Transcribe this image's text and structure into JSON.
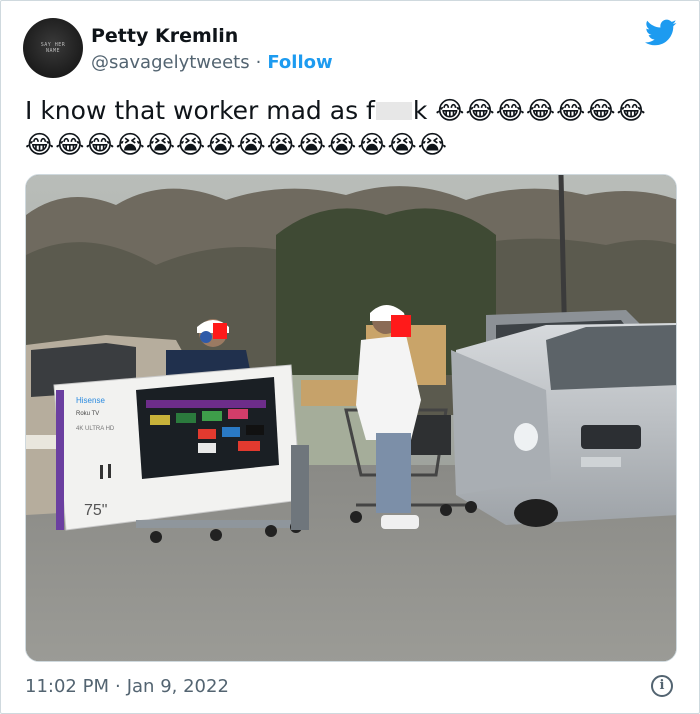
{
  "author": {
    "display_name": "Petty Kremlin",
    "handle": "@savagelytweets",
    "separator": "·",
    "follow_label": "Follow",
    "avatar_text": "SAY HER NAME"
  },
  "tweet": {
    "text_before": "I know that worker mad as f",
    "text_after": "k",
    "emoji_line1": "😂😂😂😂😂😂😂",
    "emoji_line2": "😂😂😂😭😭😭😭😭😭😭😭😭😭😭"
  },
  "photo": {
    "tv_brand": "Hisense",
    "tv_subtitle": "Roku TV",
    "tv_size": "75\"",
    "tv_model": "4K ULTRA HD"
  },
  "footer": {
    "time": "11:02 PM",
    "separator": "·",
    "date": "Jan 9, 2022"
  },
  "colors": {
    "accent": "#1d9bf0",
    "secondary_text": "#536471",
    "primary_text": "#0f1419",
    "border": "#cfd9de"
  },
  "icons": {
    "brand": "twitter-bird-icon",
    "info": "info-icon"
  }
}
